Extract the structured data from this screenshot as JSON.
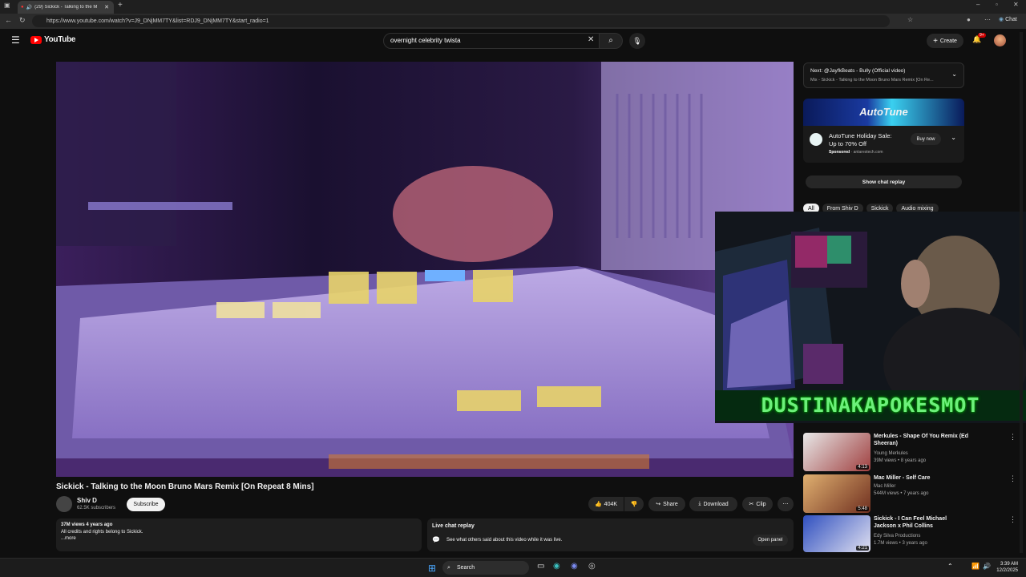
{
  "browser": {
    "tab_title": "(29) Sickick - Talking to the M",
    "url": "https://www.youtube.com/watch?v=J9_DNjMM7TY&list=RDJ9_DNjMM7TY&start_radio=1",
    "chat_label": "Chat"
  },
  "header": {
    "logo_text": "YouTube",
    "search_value": "overnight celebrity twista",
    "create_label": "Create",
    "notif_count": "9+"
  },
  "video": {
    "title": "Sickick - Talking to the Moon Bruno Mars Remix [On Repeat 8 Mins]",
    "channel": "Shiv D",
    "subscribers": "62.5K subscribers",
    "subscribe_label": "Subscribe",
    "likes": "404K",
    "share_label": "Share",
    "download_label": "Download",
    "clip_label": "Clip"
  },
  "description": {
    "stats": "37M views  4 years ago",
    "text": "All credits and rights belong to Sickick.",
    "more": "...more"
  },
  "live_chat": {
    "title": "Live chat replay",
    "text": "See what others said about this video while it was live.",
    "open_label": "Open panel"
  },
  "next_up": {
    "title": "Next: @JayfkBeats - Bully (Official video)",
    "subtitle": "Mix - Sickick - Talking to the Moon Bruno Mars Remix [On Re..."
  },
  "ad": {
    "banner": "AutoTune",
    "title": "AutoTune Holiday Sale: Up to 70% Off",
    "sponsored": "Sponsored",
    "domain": "antarestech.com",
    "buy_label": "Buy now"
  },
  "chat_replay_button": "Show chat replay",
  "chips": [
    "All",
    "From Shiv D",
    "Sickick",
    "Audio mixing"
  ],
  "overlay_text": "DUSTINAKAPOKESMOT",
  "recommendations": [
    {
      "title": "Merkules - Shape Of You Remix (Ed Sheeran)",
      "channel": "Young Merkules",
      "meta": "39M views • 8 years ago",
      "duration": "4:13"
    },
    {
      "title": "Mac Miller - Self Care",
      "channel": "Mac Miller",
      "meta": "544M views • 7 years ago",
      "duration": "5:48"
    },
    {
      "title": "Sickick - I Can Feel Michael Jackson x Phil Collins",
      "channel": "Edy Silva Productions",
      "meta": "1.7M views • 3 years ago",
      "duration": "4:21"
    }
  ],
  "taskbar": {
    "search_label": "Search",
    "time": "3:39 AM",
    "date": "12/2/2025"
  }
}
